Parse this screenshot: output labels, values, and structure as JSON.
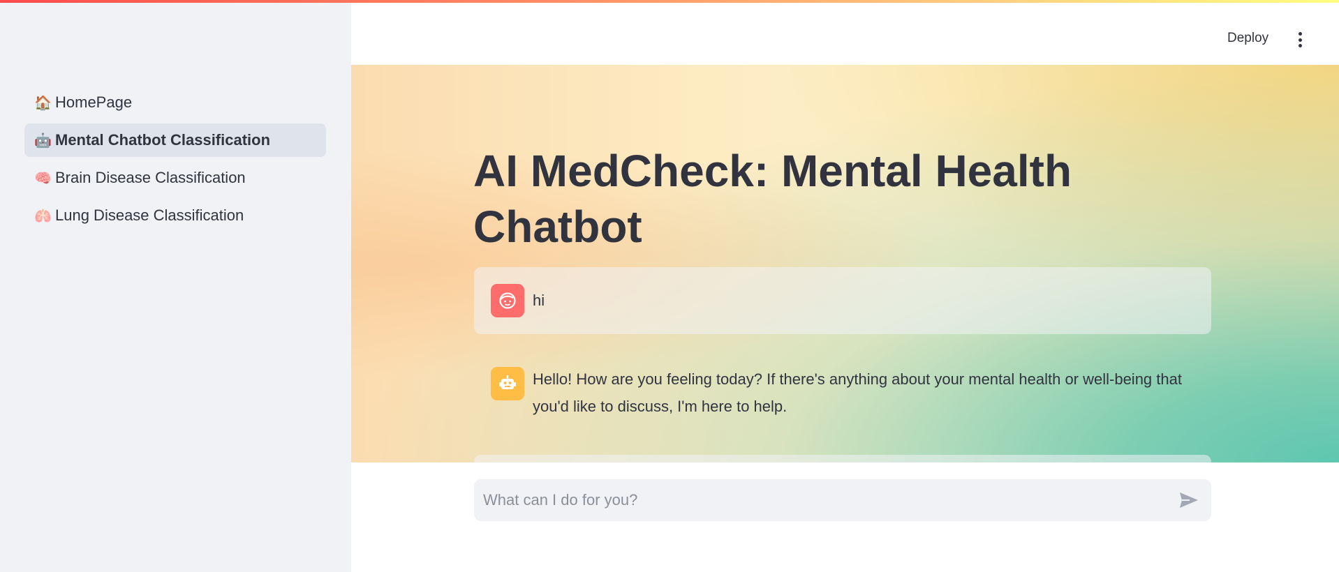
{
  "header": {
    "deploy_label": "Deploy",
    "menu_icon": "kebab-menu-icon"
  },
  "sidebar": {
    "items": [
      {
        "label": "HomePage",
        "icon": "🏠",
        "icon_name": "house-icon",
        "active": false
      },
      {
        "label": "Mental Chatbot Classification",
        "icon": "🤖",
        "icon_name": "robot-icon",
        "active": true
      },
      {
        "label": "Brain Disease Classification",
        "icon": "🧠",
        "icon_name": "brain-icon",
        "active": false
      },
      {
        "label": "Lung Disease Classification",
        "icon": "🫁",
        "icon_name": "lungs-icon",
        "active": false
      }
    ]
  },
  "main": {
    "title": "AI MedCheck: Mental Health Chatbot",
    "messages": [
      {
        "role": "user",
        "avatar": "user-face-icon",
        "text": "hi"
      },
      {
        "role": "assistant",
        "avatar": "bot-icon",
        "text": "Hello! How are you feeling today? If there's anything about your mental health or well-being that you'd like to discuss, I'm here to help."
      }
    ]
  },
  "chat_input": {
    "placeholder": "What can I do for you?",
    "value": "",
    "send_icon": "send-icon"
  },
  "colors": {
    "sidebar_bg": "#f0f2f6",
    "active_nav_bg": "#dfe3ec",
    "text": "#31333f",
    "user_avatar": "#ff6c6c",
    "bot_avatar": "#ffbd45",
    "top_decoration": "#ff4b4b"
  }
}
